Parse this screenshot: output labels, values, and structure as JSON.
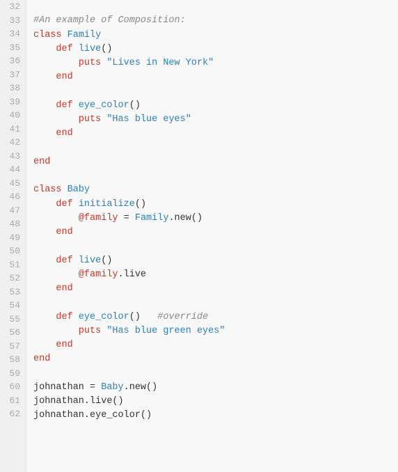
{
  "editor": {
    "lines": [
      {
        "num": "32",
        "content": []
      },
      {
        "num": "33",
        "content": [
          {
            "type": "comment",
            "text": "#An example of Composition:"
          }
        ]
      },
      {
        "num": "34",
        "content": [
          {
            "type": "kw-class",
            "text": "class"
          },
          {
            "type": "plain",
            "text": " "
          },
          {
            "type": "class-name",
            "text": "Family"
          }
        ]
      },
      {
        "num": "35",
        "content": [
          {
            "type": "plain",
            "text": "    "
          },
          {
            "type": "kw-def",
            "text": "def"
          },
          {
            "type": "plain",
            "text": " "
          },
          {
            "type": "method-name",
            "text": "live"
          },
          {
            "type": "plain",
            "text": "()"
          }
        ]
      },
      {
        "num": "36",
        "content": [
          {
            "type": "plain",
            "text": "        "
          },
          {
            "type": "kw-puts",
            "text": "puts"
          },
          {
            "type": "plain",
            "text": " "
          },
          {
            "type": "string",
            "text": "\"Lives in New York\""
          }
        ]
      },
      {
        "num": "37",
        "content": [
          {
            "type": "plain",
            "text": "    "
          },
          {
            "type": "kw-end",
            "text": "end"
          }
        ]
      },
      {
        "num": "38",
        "content": []
      },
      {
        "num": "39",
        "content": [
          {
            "type": "plain",
            "text": "    "
          },
          {
            "type": "kw-def",
            "text": "def"
          },
          {
            "type": "plain",
            "text": " "
          },
          {
            "type": "method-name",
            "text": "eye_color"
          },
          {
            "type": "plain",
            "text": "()"
          }
        ]
      },
      {
        "num": "40",
        "content": [
          {
            "type": "plain",
            "text": "        "
          },
          {
            "type": "kw-puts",
            "text": "puts"
          },
          {
            "type": "plain",
            "text": " "
          },
          {
            "type": "string",
            "text": "\"Has blue eyes\""
          }
        ]
      },
      {
        "num": "41",
        "content": [
          {
            "type": "plain",
            "text": "    "
          },
          {
            "type": "kw-end",
            "text": "end"
          }
        ]
      },
      {
        "num": "42",
        "content": []
      },
      {
        "num": "43",
        "content": [
          {
            "type": "kw-end",
            "text": "end"
          }
        ]
      },
      {
        "num": "44",
        "content": []
      },
      {
        "num": "45",
        "content": [
          {
            "type": "kw-class",
            "text": "class"
          },
          {
            "type": "plain",
            "text": " "
          },
          {
            "type": "class-name",
            "text": "Baby"
          }
        ]
      },
      {
        "num": "46",
        "content": [
          {
            "type": "plain",
            "text": "    "
          },
          {
            "type": "kw-def",
            "text": "def"
          },
          {
            "type": "plain",
            "text": " "
          },
          {
            "type": "method-name",
            "text": "initialize"
          },
          {
            "type": "plain",
            "text": "()"
          }
        ]
      },
      {
        "num": "47",
        "content": [
          {
            "type": "plain",
            "text": "        "
          },
          {
            "type": "ivar",
            "text": "@family"
          },
          {
            "type": "plain",
            "text": " = "
          },
          {
            "type": "class-name",
            "text": "Family"
          },
          {
            "type": "plain",
            "text": ".new()"
          }
        ]
      },
      {
        "num": "48",
        "content": [
          {
            "type": "plain",
            "text": "    "
          },
          {
            "type": "kw-end",
            "text": "end"
          }
        ]
      },
      {
        "num": "49",
        "content": []
      },
      {
        "num": "50",
        "content": [
          {
            "type": "plain",
            "text": "    "
          },
          {
            "type": "kw-def",
            "text": "def"
          },
          {
            "type": "plain",
            "text": " "
          },
          {
            "type": "method-name",
            "text": "live"
          },
          {
            "type": "plain",
            "text": "()"
          }
        ]
      },
      {
        "num": "51",
        "content": [
          {
            "type": "plain",
            "text": "        "
          },
          {
            "type": "ivar",
            "text": "@family"
          },
          {
            "type": "plain",
            "text": ".live"
          }
        ]
      },
      {
        "num": "52",
        "content": [
          {
            "type": "plain",
            "text": "    "
          },
          {
            "type": "kw-end",
            "text": "end"
          }
        ]
      },
      {
        "num": "53",
        "content": []
      },
      {
        "num": "54",
        "content": [
          {
            "type": "plain",
            "text": "    "
          },
          {
            "type": "kw-def",
            "text": "def"
          },
          {
            "type": "plain",
            "text": " "
          },
          {
            "type": "method-name",
            "text": "eye_color"
          },
          {
            "type": "plain",
            "text": "()   "
          },
          {
            "type": "comment",
            "text": "#override"
          }
        ]
      },
      {
        "num": "55",
        "content": [
          {
            "type": "plain",
            "text": "        "
          },
          {
            "type": "kw-puts",
            "text": "puts"
          },
          {
            "type": "plain",
            "text": " "
          },
          {
            "type": "string",
            "text": "\"Has blue green eyes\""
          }
        ]
      },
      {
        "num": "56",
        "content": [
          {
            "type": "plain",
            "text": "    "
          },
          {
            "type": "kw-end",
            "text": "end"
          }
        ]
      },
      {
        "num": "57",
        "content": [
          {
            "type": "kw-end",
            "text": "end"
          }
        ]
      },
      {
        "num": "58",
        "content": []
      },
      {
        "num": "59",
        "content": [
          {
            "type": "plain",
            "text": "johnathan = "
          },
          {
            "type": "class-name",
            "text": "Baby"
          },
          {
            "type": "plain",
            "text": ".new()"
          }
        ]
      },
      {
        "num": "60",
        "content": [
          {
            "type": "plain",
            "text": "johnathan.live()"
          }
        ]
      },
      {
        "num": "61",
        "content": [
          {
            "type": "plain",
            "text": "johnathan.eye_color()"
          }
        ]
      },
      {
        "num": "62",
        "content": []
      }
    ]
  }
}
